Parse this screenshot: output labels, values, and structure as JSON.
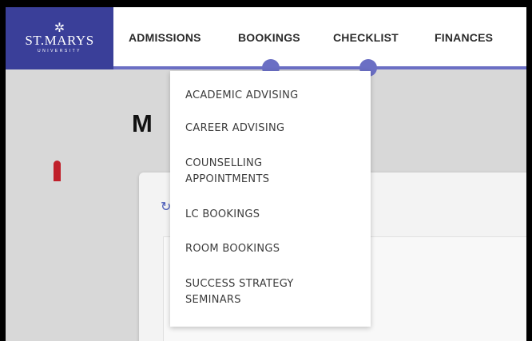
{
  "logo": {
    "star": "✲",
    "name": "ST.MARYS",
    "subtitle": "UNIVERSITY"
  },
  "nav": {
    "items": [
      {
        "label": "ADMISSIONS"
      },
      {
        "label": "BOOKINGS"
      },
      {
        "label": "CHECKLIST"
      },
      {
        "label": "FINANCES"
      }
    ]
  },
  "page": {
    "title_fragment": "M"
  },
  "card": {
    "refresh_icon": "↻"
  },
  "dropdown": {
    "items": [
      {
        "label": "ACADEMIC ADVISING"
      },
      {
        "label": "CAREER ADVISING"
      },
      {
        "label": "COUNSELLING APPOINTMENTS"
      },
      {
        "label": "LC BOOKINGS"
      },
      {
        "label": "ROOM BOOKINGS"
      },
      {
        "label": "SUCCESS STRATEGY SEMINARS"
      }
    ]
  },
  "colors": {
    "brand": "#3a3f99",
    "accent": "#6b6fc4",
    "background": "#d8d8d8",
    "marker": "#c0202a"
  }
}
